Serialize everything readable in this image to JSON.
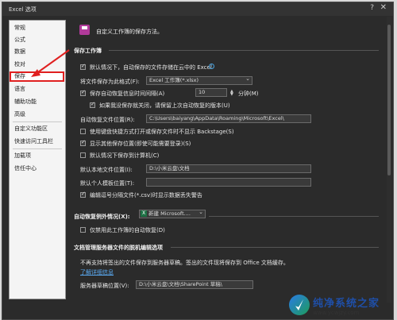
{
  "window": {
    "title": "Excel 选项",
    "help": "?",
    "close": "✕"
  },
  "sidebar": {
    "items": [
      {
        "label": "常规"
      },
      {
        "label": "公式"
      },
      {
        "label": "数据"
      },
      {
        "label": "校对"
      },
      {
        "label": "保存"
      },
      {
        "label": "语言"
      },
      {
        "label": "辅助功能"
      },
      {
        "label": "高级"
      },
      {
        "label": "自定义功能区"
      },
      {
        "label": "快速访问工具栏"
      },
      {
        "label": "加载项"
      },
      {
        "label": "信任中心"
      }
    ],
    "selected": "保存"
  },
  "header": {
    "text": "自定义工作簿的保存方法。"
  },
  "save_workbooks": {
    "title": "保存工作簿",
    "autosave_cloud": "默认情况下，自动保存的文件存储在云中的 Excel",
    "format_label": "将文件保存为此格式(F):",
    "format_value": "Excel 工作簿(*.xlsx)",
    "autorecover_label": "保存自动恢复信息时间间隔(A)",
    "autorecover_minutes": "10",
    "minutes_unit": "分钟(M)",
    "keep_last_version": "如果我没保存就关闭，请保留上次自动恢复的版本(U)",
    "autorecover_location_label": "自动恢复文件位置(R):",
    "autorecover_location_value": "C:\\Users\\baiyang\\AppData\\Roaming\\Microsoft\\Excel\\",
    "no_backstage": "使用键盘快捷方式打开或保存文件时不显示 Backstage(S)",
    "show_additional": "显示其他保存位置(即使可能需要登录)(S)",
    "save_to_computer": "默认情况下保存到计算机(C)",
    "local_location_label": "默认本地文件位置(I):",
    "local_location_value": "D:\\小米云盘\\文档",
    "personal_templates_label": "默认个人模板位置(T):",
    "personal_templates_value": "",
    "csv_warning": "编辑逗号分隔文件(*.csv)时显示数据丢失警告"
  },
  "autorecover_exceptions": {
    "title": "自动恢复例外情况(X):",
    "workbook_value": "新建 Microsoft....",
    "disable_label": "仅禁用此工作簿的自动恢复(D)"
  },
  "offline_editing": {
    "title": "文档管理服务器文件的脱机编辑选项",
    "note": "不再支持将签出的文件保存到服务器草稿。签出的文件现将保存到 Office 文档缓存。",
    "learn_more": "了解详细信息",
    "drafts_label": "服务器草稿位置(V):",
    "drafts_value": "D:\\小米云盘\\文档\\SharePoint 草稿\\"
  },
  "watermark": {
    "title": "纯净系统之家",
    "url": "www.ycwjzy.com"
  }
}
